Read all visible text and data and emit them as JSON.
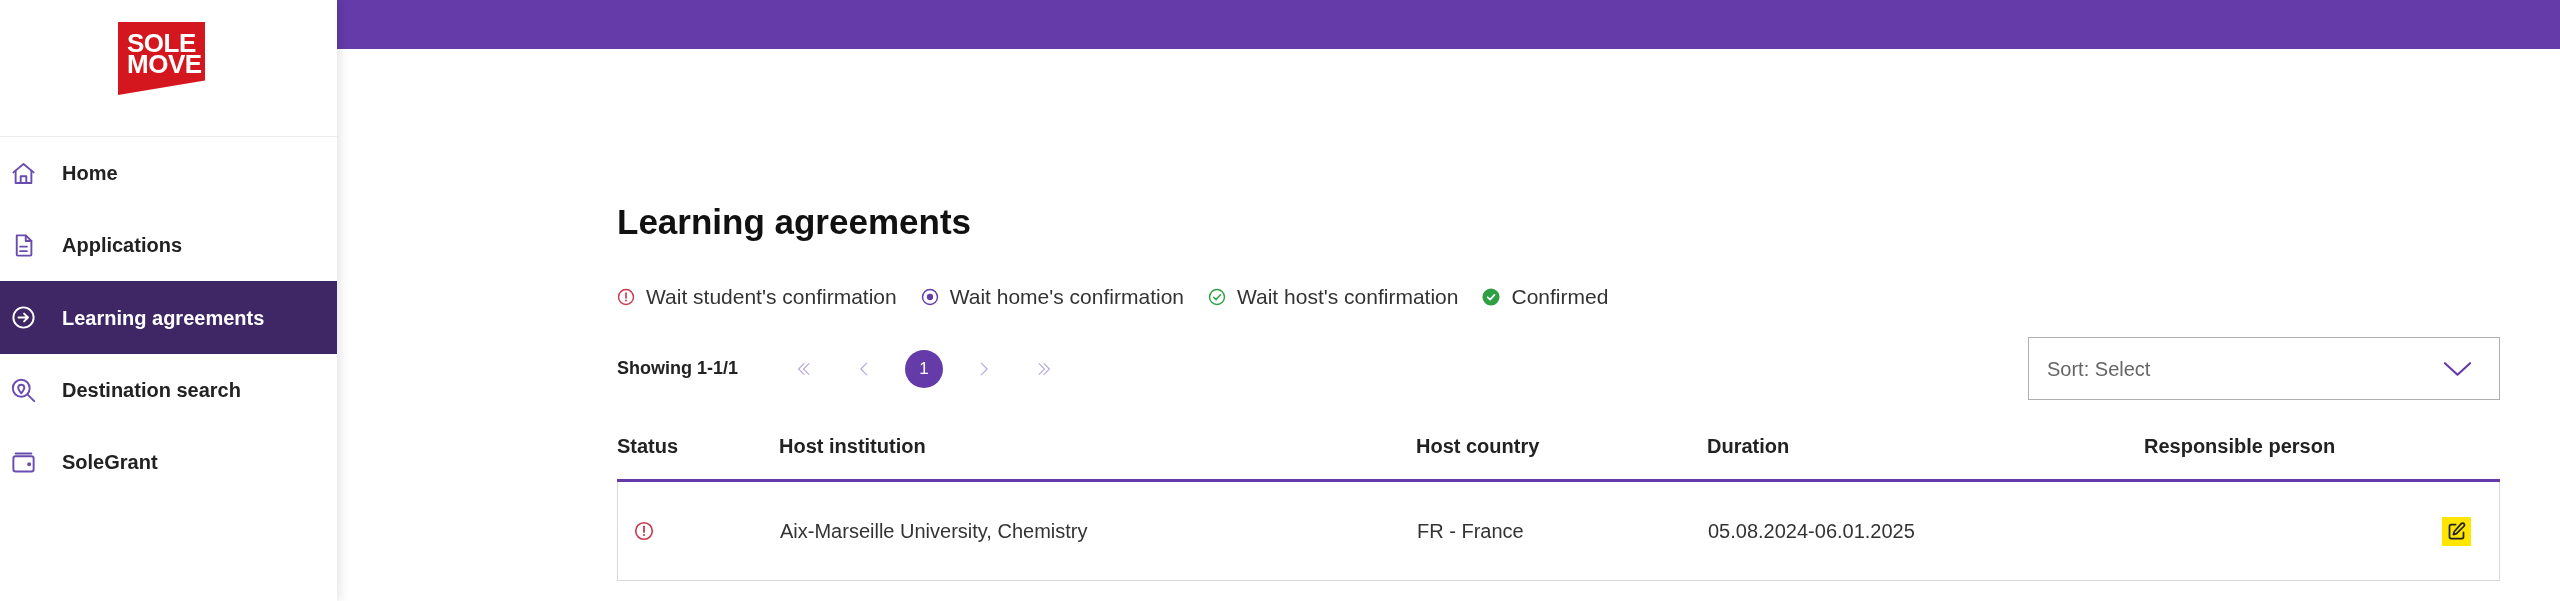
{
  "sidebar": {
    "logo": {
      "lines": [
        "SOLE",
        "MOVE"
      ]
    },
    "items": [
      {
        "label": "Home",
        "kind": "home",
        "selected": false
      },
      {
        "label": "Applications",
        "kind": "document",
        "selected": false
      },
      {
        "label": "Learning agreements",
        "kind": "arrow",
        "selected": true
      },
      {
        "label": "Destination search",
        "kind": "pin-search",
        "selected": false
      },
      {
        "label": "SoleGrant",
        "kind": "wallet",
        "selected": false
      }
    ]
  },
  "page": {
    "title": "Learning agreements",
    "legend": [
      {
        "label": "Wait student's confirmation",
        "kind": "alert",
        "color": "#c8374c"
      },
      {
        "label": "Wait home's confirmation",
        "kind": "dot",
        "color": "#643ba9"
      },
      {
        "label": "Wait host's confirmation",
        "kind": "check",
        "color": "#2ea043"
      },
      {
        "label": "Confirmed",
        "kind": "check-filled",
        "color": "#2ea043"
      }
    ],
    "pagination": {
      "summary": "Showing 1-1/1",
      "controls": [
        {
          "kind": "first",
          "disabled": true
        },
        {
          "kind": "prev",
          "disabled": true
        },
        {
          "kind": "page",
          "label": "1",
          "selected": true
        },
        {
          "kind": "next",
          "disabled": true
        },
        {
          "kind": "last",
          "disabled": true
        }
      ]
    },
    "sort": {
      "label": "Sort: Select"
    },
    "table": {
      "columns": [
        "Status",
        "Host institution",
        "Host country",
        "Duration",
        "Responsible person"
      ],
      "rows": [
        {
          "status": {
            "kind": "alert",
            "color": "#c8374c"
          },
          "host_institution": "Aix-Marseille University, Chemistry",
          "host_country": "FR - France",
          "duration": "05.08.2024-06.01.2025"
        }
      ]
    }
  }
}
